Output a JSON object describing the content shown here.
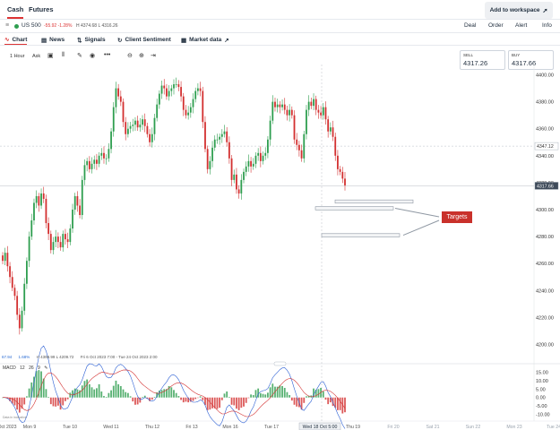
{
  "top_tabs": [
    "Cash",
    "Futures"
  ],
  "add_workspace": "Add to workspace",
  "instrument": {
    "name": "US 500",
    "change": "-55.92 -1.28%",
    "high_low": "H 4374.68 L 4316.26",
    "actions": [
      "Deal",
      "Order",
      "Alert",
      "Info"
    ]
  },
  "chart_tabs": [
    "Chart",
    "News",
    "Signals",
    "Client Sentiment",
    "Market data"
  ],
  "toolbar": {
    "interval": "1 Hour",
    "side": "Ask"
  },
  "sell": {
    "label": "SELL",
    "value": "4317.26"
  },
  "buy": {
    "label": "BUY",
    "value": "4317.66"
  },
  "stats": {
    "v1": "67.94",
    "v2": "1.68%",
    "hl": "H 4398.99 L 4209.72",
    "range": "Fri 6 Oct 2023 7:00 - Tue 24 Oct 2023 2:00"
  },
  "macd_legend": [
    "MACD",
    "12",
    "26",
    "9"
  ],
  "small_note": "Data in indicative",
  "annotation": "Targets",
  "colors": {
    "up": "#2e9e4f",
    "down": "#d33030",
    "accent": "#c9312b",
    "macd_line": "#2b5fd4",
    "signal_line": "#d33030"
  },
  "chart_data": {
    "type": "candlestick",
    "price_axis": {
      "ticks": [
        4400.0,
        4380.0,
        4360.0,
        4340.0,
        4320.0,
        4300.0,
        4280.0,
        4260.0,
        4240.0,
        4220.0,
        4200.0
      ],
      "ylim": [
        4195,
        4405
      ],
      "markers": [
        {
          "value": 4347.12,
          "label": "4347.12"
        },
        {
          "value": 4317.66,
          "label": "4317.66"
        }
      ]
    },
    "time_axis": {
      "labels": [
        "Oct 2023",
        "Mon 9",
        "Tue 10",
        "Wed 11",
        "Thu 12",
        "Fri 13",
        "Mon 16",
        "Tue 17",
        "Wed 18 Oct 5:00",
        "Thu 19",
        "Fri 20",
        "Sat 21",
        "Sun 22",
        "Mon 23",
        "Tue 24"
      ],
      "highlight": "Wed 18 Oct 5:00",
      "crosshair_label": "Wed 18 Oct 5:00"
    },
    "series_close": [
      4262,
      4268,
      4258,
      4250,
      4242,
      4236,
      4222,
      4212,
      4225,
      4245,
      4262,
      4280,
      4292,
      4305,
      4310,
      4303,
      4312,
      4308,
      4290,
      4282,
      4270,
      4276,
      4280,
      4276,
      4272,
      4282,
      4278,
      4276,
      4286,
      4300,
      4310,
      4303,
      4296,
      4322,
      4333,
      4336,
      4330,
      4334,
      4337,
      4334,
      4340,
      4342,
      4338,
      4338,
      4345,
      4358,
      4376,
      4390,
      4384,
      4380,
      4365,
      4356,
      4360,
      4362,
      4363,
      4366,
      4361,
      4363,
      4367,
      4362,
      4356,
      4350,
      4356,
      4368,
      4378,
      4386,
      4392,
      4390,
      4384,
      4388,
      4390,
      4393,
      4393,
      4391,
      4384,
      4374,
      4370,
      4372,
      4376,
      4382,
      4388,
      4390,
      4388,
      4365,
      4345,
      4330,
      4336,
      4346,
      4352,
      4352,
      4354,
      4356,
      4358,
      4350,
      4338,
      4322,
      4326,
      4315,
      4312,
      4322,
      4328,
      4332,
      4336,
      4332,
      4334,
      4340,
      4342,
      4336,
      4340,
      4342,
      4352,
      4366,
      4380,
      4376,
      4378,
      4376,
      4378,
      4374,
      4370,
      4374,
      4370,
      4352,
      4348,
      4344,
      4338,
      4356,
      4374,
      4380,
      4377,
      4382,
      4374,
      4372,
      4370,
      4376,
      4367,
      4358,
      4361,
      4354,
      4340,
      4330,
      4328,
      4323,
      4318
    ],
    "target_lines": [
      4306,
      4301,
      4281
    ],
    "macd_axis": {
      "ticks": [
        15.0,
        10.0,
        5.0,
        0.0,
        -5.0,
        -10.0
      ],
      "labels": [
        "15.00",
        "10.00",
        "5.00",
        "0.00",
        "-5.00",
        "-10.00"
      ]
    }
  }
}
